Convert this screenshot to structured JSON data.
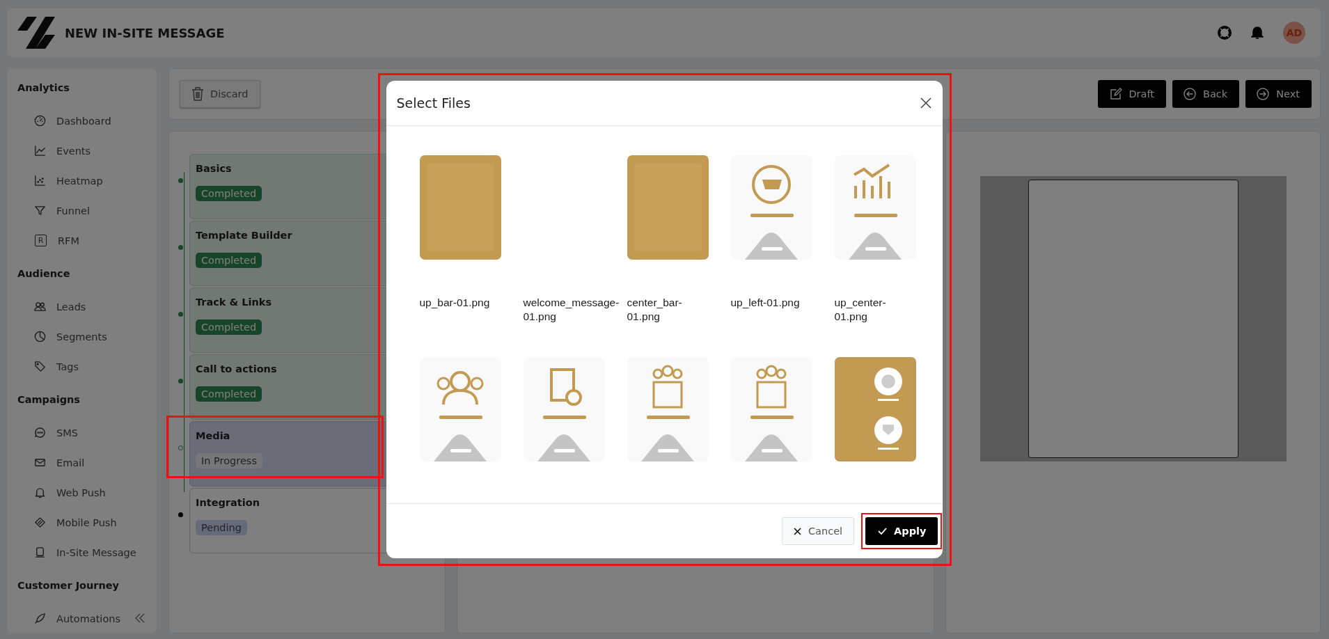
{
  "header": {
    "title": "NEW IN-SITE MESSAGE",
    "avatar": "AD"
  },
  "sidebar": {
    "sections": [
      {
        "title": "Analytics",
        "items": [
          {
            "label": "Dashboard"
          },
          {
            "label": "Events"
          },
          {
            "label": "Heatmap"
          },
          {
            "label": "Funnel"
          },
          {
            "label": "RFM",
            "glyph": "R"
          }
        ]
      },
      {
        "title": "Audience",
        "items": [
          {
            "label": "Leads"
          },
          {
            "label": "Segments"
          },
          {
            "label": "Tags"
          }
        ]
      },
      {
        "title": "Campaigns",
        "items": [
          {
            "label": "SMS"
          },
          {
            "label": "Email"
          },
          {
            "label": "Web Push"
          },
          {
            "label": "Mobile Push"
          },
          {
            "label": "In-Site Message"
          }
        ]
      },
      {
        "title": "Customer Journey",
        "items": [
          {
            "label": "Automations"
          }
        ]
      }
    ]
  },
  "toolbar": {
    "discard": "Discard",
    "actions": [
      {
        "label": "Draft"
      },
      {
        "label": "Back"
      },
      {
        "label": "Next"
      }
    ]
  },
  "steps": [
    {
      "title": "Basics",
      "status": "Completed",
      "completed": true,
      "active": false,
      "highlighted": false
    },
    {
      "title": "Template Builder",
      "status": "Completed",
      "completed": true,
      "active": false,
      "highlighted": false
    },
    {
      "title": "Track & Links",
      "status": "Completed",
      "completed": true,
      "active": false,
      "highlighted": false
    },
    {
      "title": "Call to actions",
      "status": "Completed",
      "completed": true,
      "active": false,
      "highlighted": false
    },
    {
      "title": "Media",
      "status": "In Progress",
      "completed": false,
      "active": true,
      "highlighted": true
    },
    {
      "title": "Integration",
      "status": "Pending",
      "completed": false,
      "active": false,
      "highlighted": false
    }
  ],
  "dialog": {
    "title": "Select Files",
    "highlighted": true,
    "files": [
      {
        "name": "up_bar-01.png",
        "kind": "picture"
      },
      {
        "name": "welcome_message-01.png",
        "kind": "blank"
      },
      {
        "name": "center_bar-01.png",
        "kind": "picture"
      },
      {
        "name": "up_left-01.png",
        "kind": "picture"
      },
      {
        "name": "up_center-01.png",
        "kind": "picture"
      },
      {
        "kind": "picture"
      },
      {
        "kind": "picture"
      },
      {
        "kind": "picture"
      },
      {
        "kind": "picture"
      },
      {
        "kind": "picture"
      }
    ],
    "cancel": "Cancel",
    "apply": {
      "label": "Apply",
      "highlighted": true
    }
  }
}
